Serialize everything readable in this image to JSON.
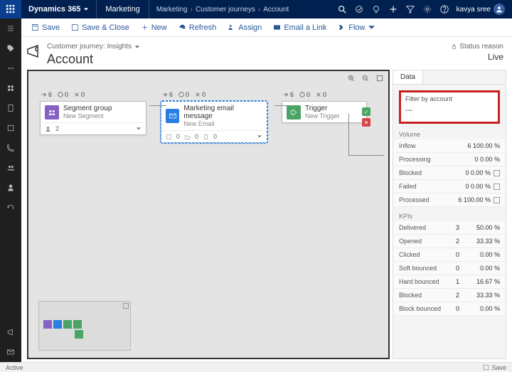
{
  "topbar": {
    "brand": "Dynamics 365",
    "module": "Marketing",
    "breadcrumbs": [
      "Marketing",
      "Customer journeys",
      "Account"
    ],
    "user_name": "kavya sree"
  },
  "commands": {
    "save": "Save",
    "save_close": "Save & Close",
    "new": "New",
    "refresh": "Refresh",
    "assign": "Assign",
    "email_link": "Email a Link",
    "flow": "Flow"
  },
  "header": {
    "subtitle": "Customer journey: Insights",
    "title": "Account",
    "status_label": "Status reason",
    "status_value": "Live"
  },
  "tiles": [
    {
      "pills": {
        "a": "6",
        "b": "0",
        "c": "0"
      },
      "icon": "purple",
      "title": "Segment group",
      "sub": "New Segment",
      "foot": [
        "2"
      ]
    },
    {
      "pills": {
        "a": "6",
        "b": "0",
        "c": "0"
      },
      "icon": "blue",
      "title": "Marketing email message",
      "sub": "New Email",
      "foot": [
        "0",
        "0",
        "0"
      ],
      "selected": true
    },
    {
      "pills": {
        "a": "6",
        "b": "0",
        "c": "0"
      },
      "icon": "green",
      "title": "Trigger",
      "sub": "New Trigger"
    }
  ],
  "side": {
    "tab": "Data",
    "filter_label": "Filter by account",
    "filter_value": "---",
    "volume_title": "Volume",
    "volume": [
      {
        "n": "Inflow",
        "v": "6 100.00 %"
      },
      {
        "n": "Processing",
        "v": "0 0.00 %"
      },
      {
        "n": "Blocked",
        "v": "0 0.00 %",
        "ic": true
      },
      {
        "n": "Failed",
        "v": "0 0.00 %",
        "ic": true
      },
      {
        "n": "Processed",
        "v": "6 100.00 %",
        "ic": true
      }
    ],
    "kpi_title": "KPIs",
    "kpis": [
      {
        "n": "Delivered",
        "c": "3",
        "p": "50.00 %"
      },
      {
        "n": "Opened",
        "c": "2",
        "p": "33.33 %"
      },
      {
        "n": "Clicked",
        "c": "0",
        "p": "0.00 %"
      },
      {
        "n": "Soft bounced",
        "c": "0",
        "p": "0.00 %"
      },
      {
        "n": "Hard bounced",
        "c": "1",
        "p": "16.67 %"
      },
      {
        "n": "Blocked",
        "c": "2",
        "p": "33.33 %"
      },
      {
        "n": "Block bounced",
        "c": "0",
        "p": "0.00 %"
      }
    ]
  },
  "statusbar": {
    "left": "Active",
    "right": "Save"
  }
}
